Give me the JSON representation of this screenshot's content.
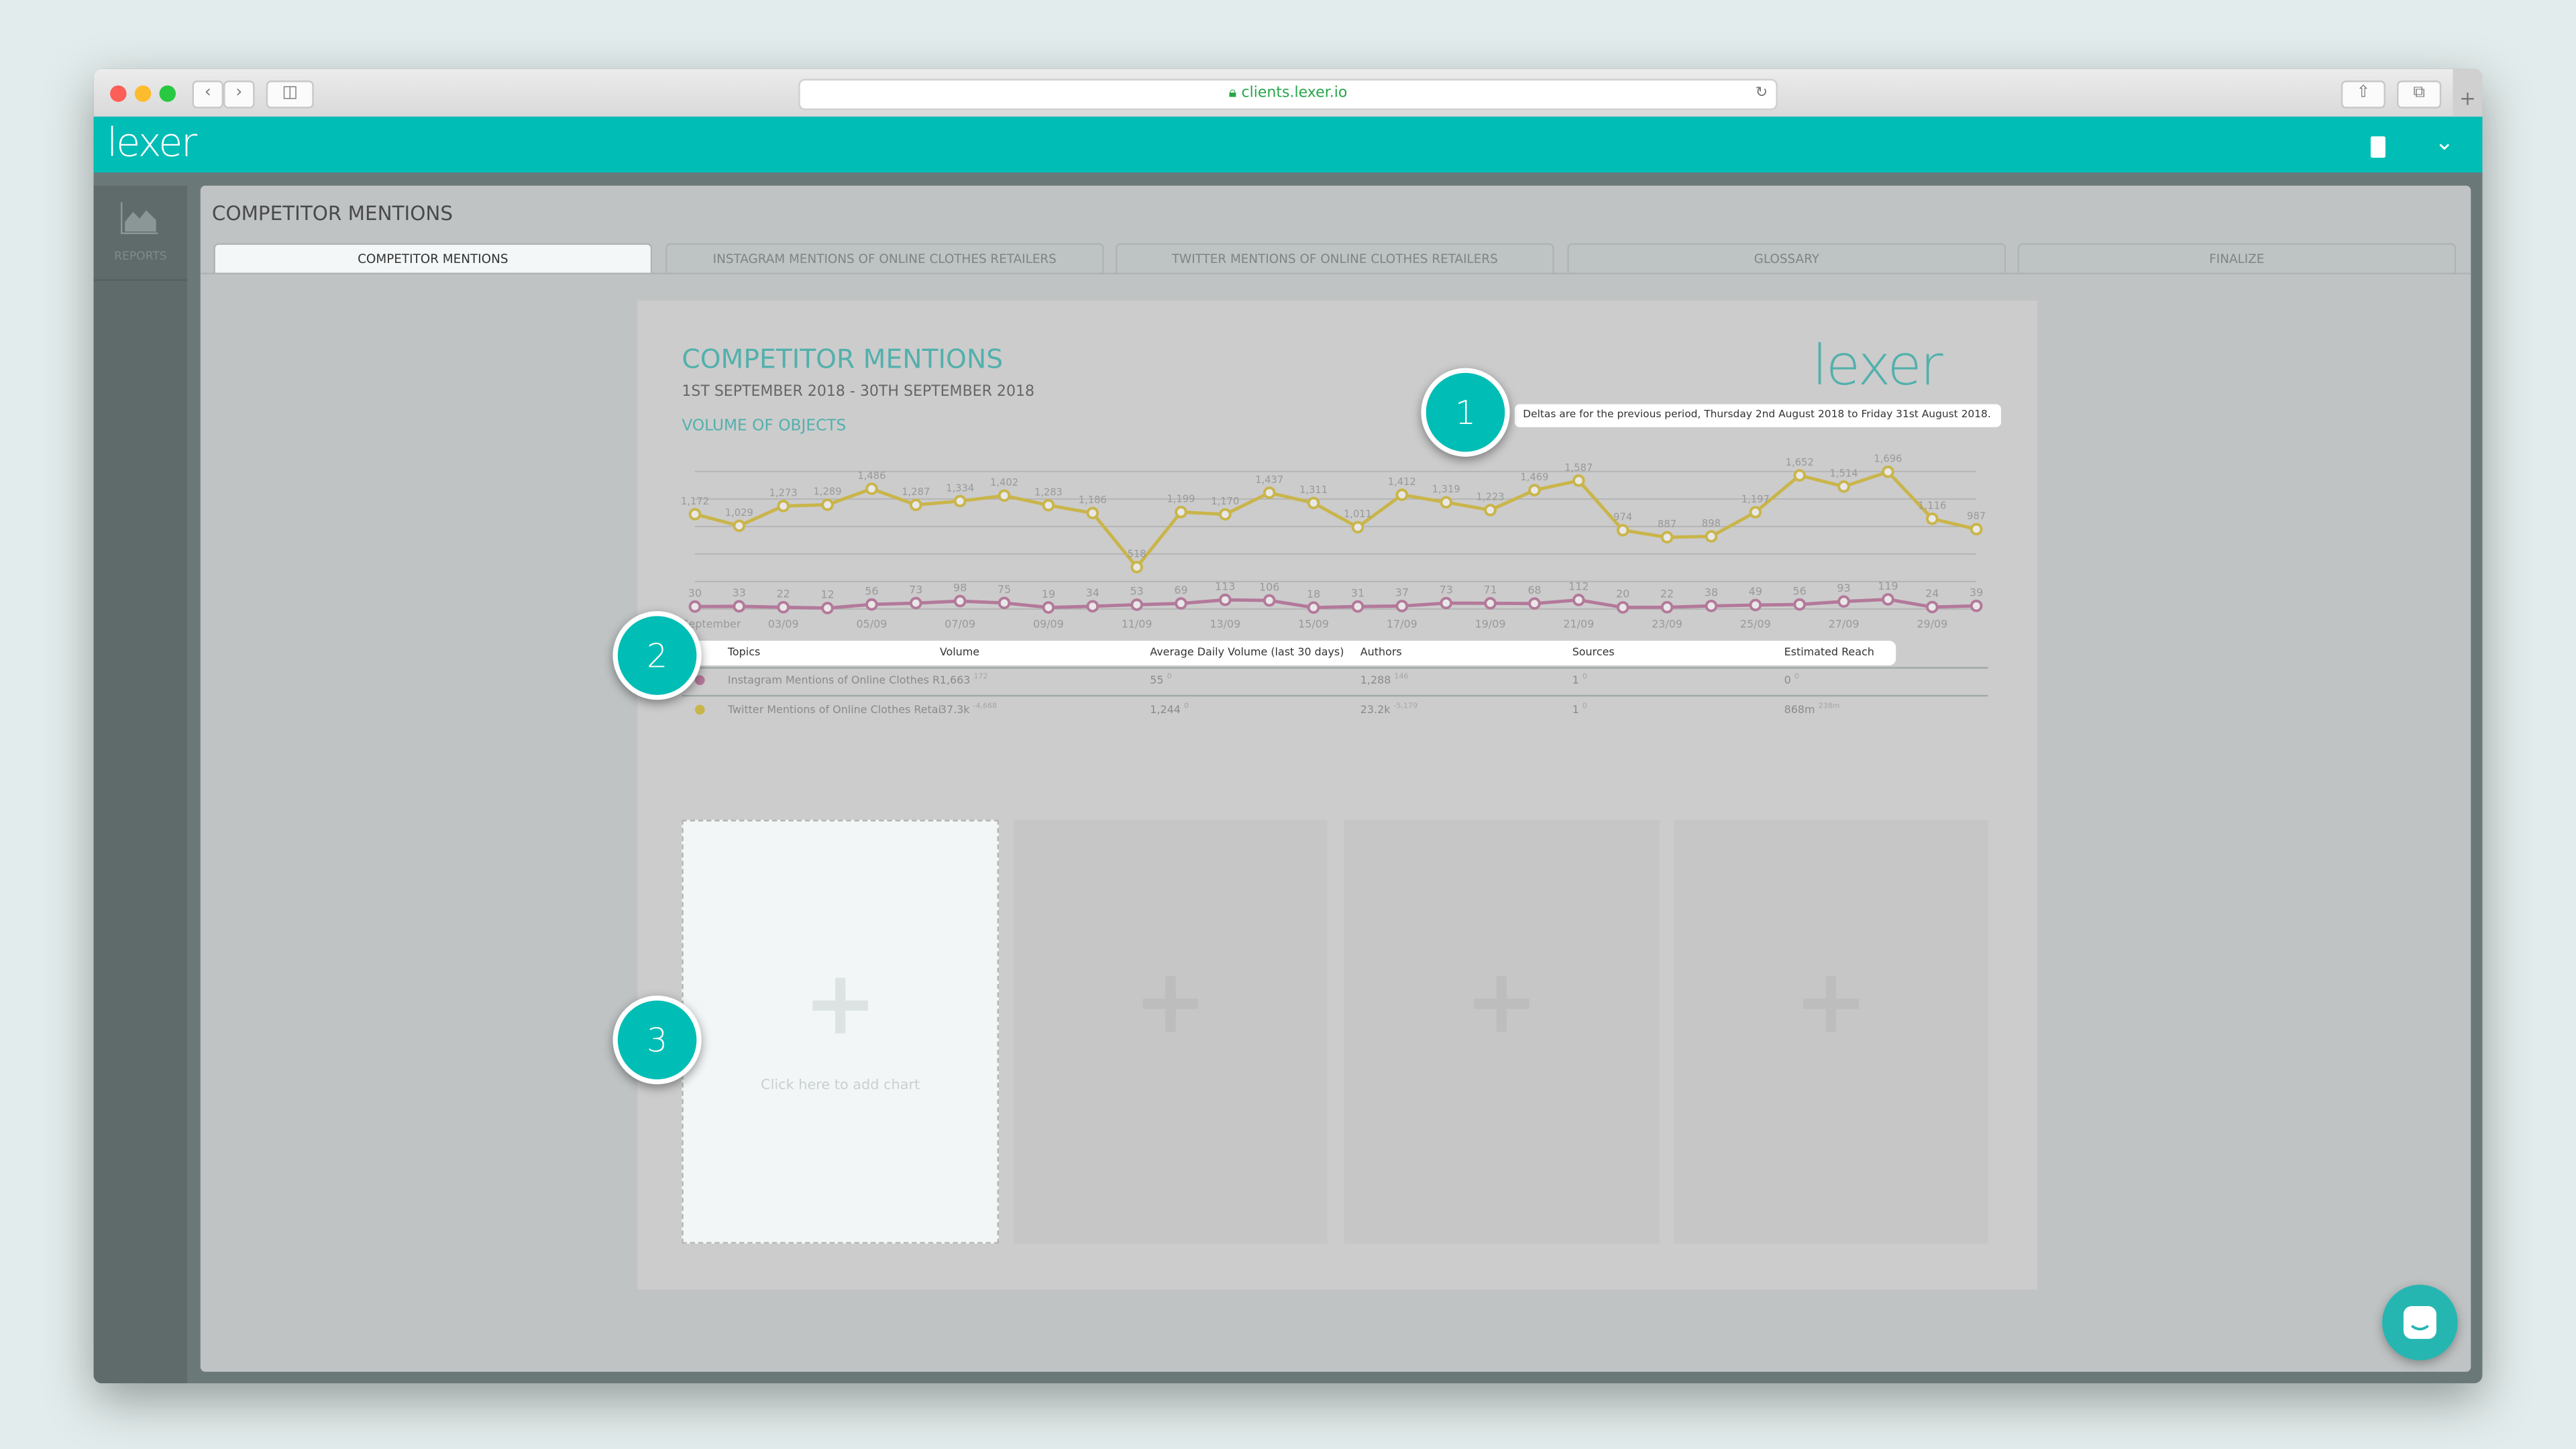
{
  "browser": {
    "url": "clients.lexer.io"
  },
  "app": {
    "logo": "lexer",
    "sidebar_item": "REPORTS"
  },
  "page": {
    "title": "COMPETITOR MENTIONS",
    "tabs": [
      {
        "label": "COMPETITOR MENTIONS",
        "active": true
      },
      {
        "label": "INSTAGRAM MENTIONS OF ONLINE CLOTHES RETAILERS",
        "active": false
      },
      {
        "label": "TWITTER MENTIONS OF ONLINE CLOTHES RETAILERS",
        "active": false
      },
      {
        "label": "GLOSSARY",
        "active": false
      },
      {
        "label": "FINALIZE",
        "active": false
      }
    ]
  },
  "report": {
    "title": "COMPETITOR MENTIONS",
    "date_range": "1ST SEPTEMBER 2018 - 30TH SEPTEMBER 2018",
    "section": "VOLUME OF OBJECTS",
    "logo": "lexer",
    "deltas_note": "Deltas are for the previous period, Thursday 2nd August 2018 to Friday 31st August 2018."
  },
  "callouts": [
    "1",
    "2",
    "3"
  ],
  "table": {
    "headers": [
      "Topics",
      "Volume",
      "Average Daily Volume (last 30 days)",
      "Authors",
      "Sources",
      "Estimated Reach"
    ],
    "rows": [
      {
        "color": "#b3799a",
        "topic": "Instagram Mentions of Online Clothes R",
        "volume": "1,663",
        "volume_delta": "172",
        "avg": "55",
        "avg_delta": "0",
        "authors": "1,288",
        "authors_delta": "146",
        "sources": "1",
        "sources_delta": "0",
        "reach": "0",
        "reach_delta": "0"
      },
      {
        "color": "#c9b54a",
        "topic": "Twitter Mentions of Online Clothes Retai",
        "volume": "37.3k",
        "volume_delta": "-4,668",
        "avg": "1,244",
        "avg_delta": "0",
        "authors": "23.2k",
        "authors_delta": "-5,179",
        "sources": "1",
        "sources_delta": "0",
        "reach": "868m",
        "reach_delta": "238m"
      }
    ]
  },
  "placeholder": {
    "add_chart": "Click here to add chart"
  },
  "colors": {
    "accent": "#00bdb5",
    "twitter_series": "#c9b54a",
    "instagram_series": "#b3799a"
  },
  "chart_data": {
    "type": "line",
    "x_tick_labels": [
      "September",
      "03/09",
      "05/09",
      "07/09",
      "09/09",
      "11/09",
      "13/09",
      "15/09",
      "17/09",
      "19/09",
      "21/09",
      "23/09",
      "25/09",
      "27/09",
      "29/09"
    ],
    "x": [
      "01/09",
      "02/09",
      "03/09",
      "04/09",
      "05/09",
      "06/09",
      "07/09",
      "08/09",
      "09/09",
      "10/09",
      "11/09",
      "12/09",
      "13/09",
      "14/09",
      "15/09",
      "16/09",
      "17/09",
      "18/09",
      "19/09",
      "20/09",
      "21/09",
      "22/09",
      "23/09",
      "24/09",
      "25/09",
      "26/09",
      "27/09",
      "28/09",
      "29/09",
      "30/09"
    ],
    "series": [
      {
        "color": "#c9b54a",
        "values": [
          1172,
          1029,
          1273,
          1289,
          1486,
          1287,
          1334,
          1402,
          1283,
          1186,
          518,
          1199,
          1170,
          1437,
          1311,
          1011,
          1412,
          1319,
          1223,
          1469,
          1587,
          974,
          887,
          898,
          1197,
          1652,
          1514,
          1696,
          1116,
          987
        ]
      },
      {
        "color": "#b3799a",
        "values": [
          30,
          33,
          22,
          12,
          56,
          73,
          98,
          75,
          19,
          34,
          53,
          69,
          113,
          106,
          18,
          31,
          37,
          73,
          71,
          68,
          112,
          20,
          22,
          38,
          49,
          56,
          93,
          119,
          24,
          39
        ]
      }
    ],
    "ylim": [
      0,
      1700
    ],
    "grid": true,
    "data_labels": true
  }
}
